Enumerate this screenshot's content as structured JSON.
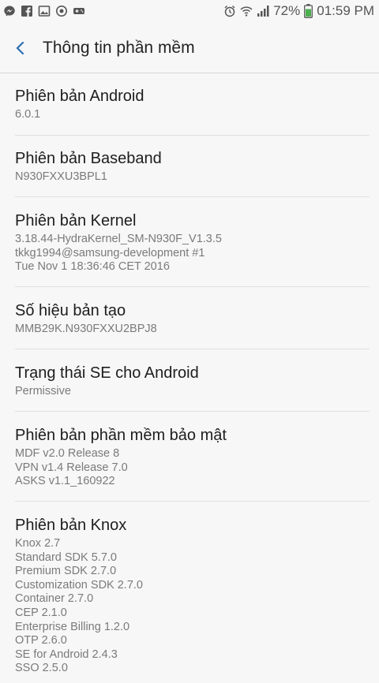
{
  "status_bar": {
    "battery": "72%",
    "time": "01:59 PM"
  },
  "header": {
    "title": "Thông tin phần mềm"
  },
  "items": [
    {
      "title": "Phiên bản Android",
      "lines": [
        "6.0.1"
      ]
    },
    {
      "title": "Phiên bản Baseband",
      "lines": [
        "N930FXXU3BPL1"
      ]
    },
    {
      "title": "Phiên bản Kernel",
      "lines": [
        "3.18.44-HydraKernel_SM-N930F_V1.3.5",
        "tkkg1994@samsung-development #1",
        "Tue Nov 1 18:36:46 CET 2016"
      ]
    },
    {
      "title": "Số hiệu bản tạo",
      "lines": [
        "MMB29K.N930FXXU2BPJ8"
      ]
    },
    {
      "title": "Trạng thái SE cho Android",
      "lines": [
        "Permissive"
      ]
    },
    {
      "title": "Phiên bản phần mềm bảo mật",
      "lines": [
        "MDF v2.0 Release 8",
        "VPN v1.4 Release 7.0",
        "ASKS v1.1_160922"
      ]
    },
    {
      "title": "Phiên bản Knox",
      "lines": [
        "Knox 2.7",
        "Standard SDK 5.7.0",
        "Premium SDK 2.7.0",
        "Customization SDK 2.7.0",
        "Container 2.7.0",
        "CEP 2.1.0",
        "Enterprise Billing 1.2.0",
        "OTP 2.6.0",
        "SE for Android 2.4.3",
        "SSO 2.5.0"
      ]
    }
  ]
}
